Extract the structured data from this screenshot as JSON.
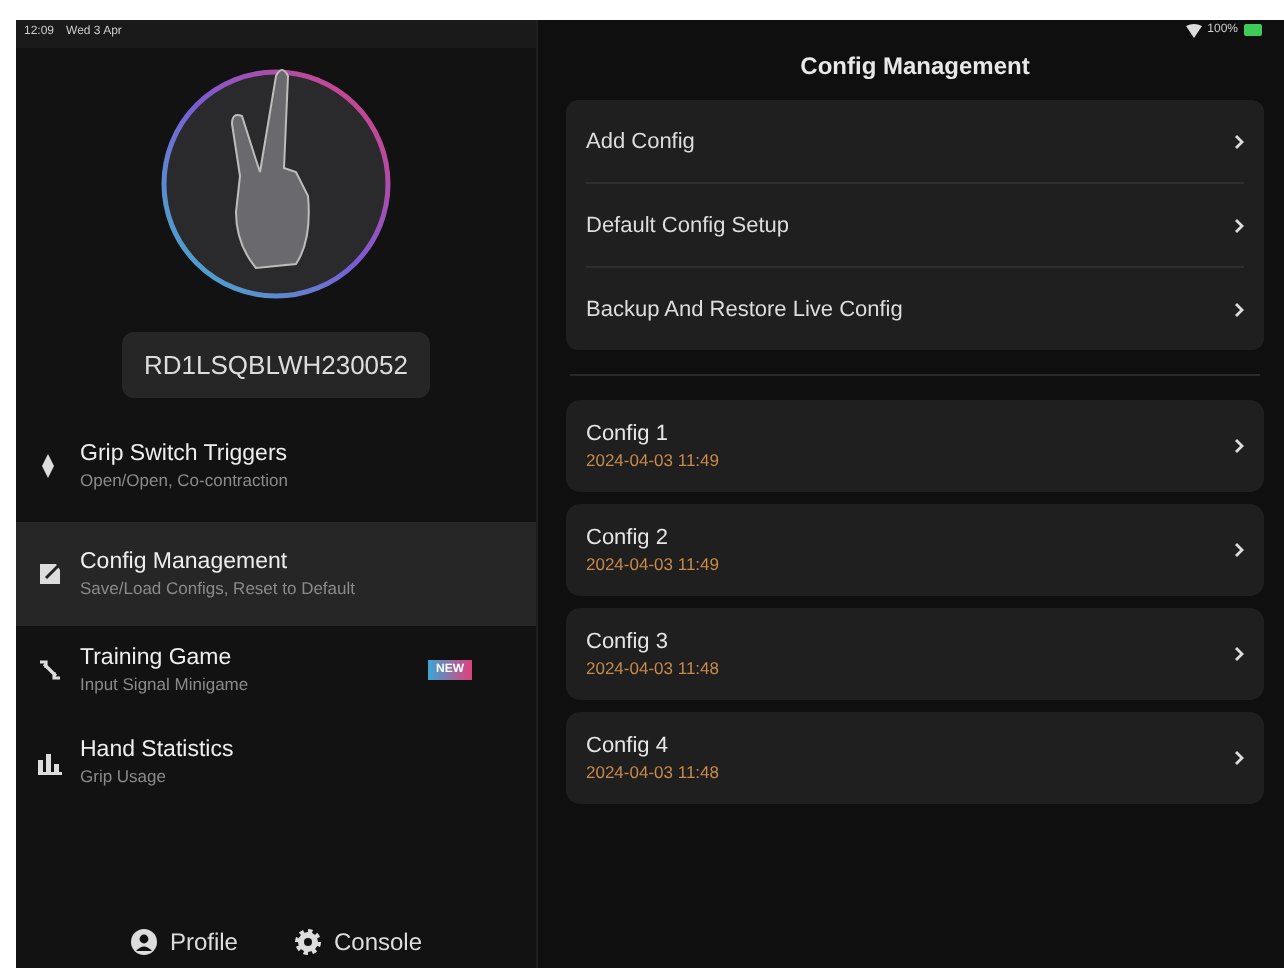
{
  "status_bar": {
    "time": "12:09",
    "date": "Wed 3 Apr",
    "battery": "100%"
  },
  "device": {
    "serial": "RD1LSQBLWH230052"
  },
  "sidebar": {
    "items": [
      {
        "kind": "grip",
        "title": "Grip Switch Triggers",
        "subtitle": "Open/Open, Co-contraction",
        "selected": false
      },
      {
        "kind": "config",
        "title": "Config Management",
        "subtitle": "Save/Load Configs, Reset to Default",
        "selected": true
      },
      {
        "kind": "game",
        "title": "Training Game",
        "subtitle": "Input Signal Minigame",
        "selected": false,
        "badge": "NEW"
      },
      {
        "kind": "stats",
        "title": "Hand Statistics",
        "subtitle": "Grip Usage",
        "selected": false
      }
    ],
    "footer": [
      {
        "kind": "profile",
        "label": "Profile"
      },
      {
        "kind": "console",
        "label": "Console"
      }
    ]
  },
  "main": {
    "title": "Config Management",
    "actions": [
      "Add Config",
      "Default Config Setup",
      "Backup And Restore Live Config"
    ],
    "configs": [
      {
        "name": "Config 1",
        "date": "2024-04-03 11:49"
      },
      {
        "name": "Config 2",
        "date": "2024-04-03 11:49"
      },
      {
        "name": "Config 3",
        "date": "2024-04-03 11:48"
      },
      {
        "name": "Config 4",
        "date": "2024-04-03 11:48"
      }
    ]
  }
}
